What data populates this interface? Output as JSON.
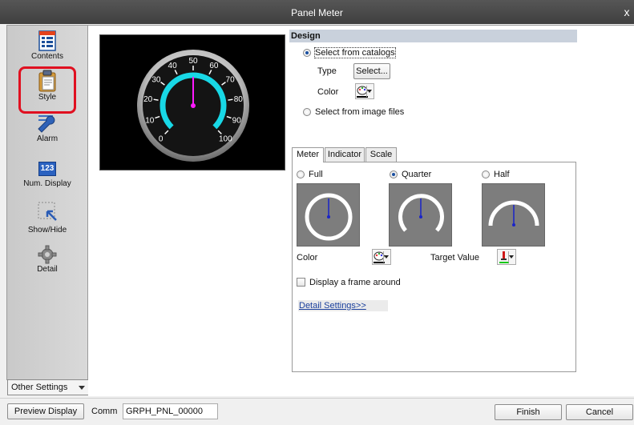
{
  "window": {
    "title": "Panel Meter",
    "close_glyph": "x"
  },
  "sidebar": {
    "items": [
      {
        "label": "Contents",
        "icon": "contents-icon"
      },
      {
        "label": "Style",
        "icon": "clipboard-icon"
      },
      {
        "label": "Alarm",
        "icon": "wrench-icon"
      },
      {
        "label": "Num. Display",
        "icon": "num-display-icon",
        "badge": "123"
      },
      {
        "label": "Show/Hide",
        "icon": "show-hide-icon"
      },
      {
        "label": "Detail",
        "icon": "gear-icon"
      }
    ],
    "selected": "Style",
    "other_settings": "Other Settings"
  },
  "preview": {
    "gauge_ticks": [
      "0",
      "10",
      "20",
      "30",
      "40",
      "50",
      "60",
      "70",
      "80",
      "90",
      "100"
    ]
  },
  "design": {
    "heading": "Design",
    "select_from_catalogs": "Select from catalogs",
    "type_label": "Type",
    "type_button": "Select...",
    "color_label": "Color",
    "select_from_image_files": "Select from image files",
    "selected_option": "Select from catalogs"
  },
  "tabs": [
    {
      "label": "Meter"
    },
    {
      "label": "Indicator"
    },
    {
      "label": "Scale"
    }
  ],
  "active_tab": "Meter",
  "meter": {
    "options": [
      {
        "label": "Full"
      },
      {
        "label": "Quarter"
      },
      {
        "label": "Half"
      }
    ],
    "selected": "Quarter",
    "color_label": "Color",
    "target_value_label": "Target Value",
    "frame_checkbox": "Display a frame around",
    "frame_checked": false,
    "detail_link": "Detail Settings>>"
  },
  "bottom": {
    "preview_button": "Preview Display",
    "comm_label": "Comm",
    "comm_value": "GRPH_PNL_00000",
    "finish_button": "Finish",
    "cancel_button": "Cancel"
  },
  "colors": {
    "accent_cyan": "#18d8e6",
    "needle_magenta": "#ff1aff",
    "highlight_red": "#e01020",
    "thumb_gray": "#7d7d7d",
    "needle_blue": "#1a24c8"
  }
}
